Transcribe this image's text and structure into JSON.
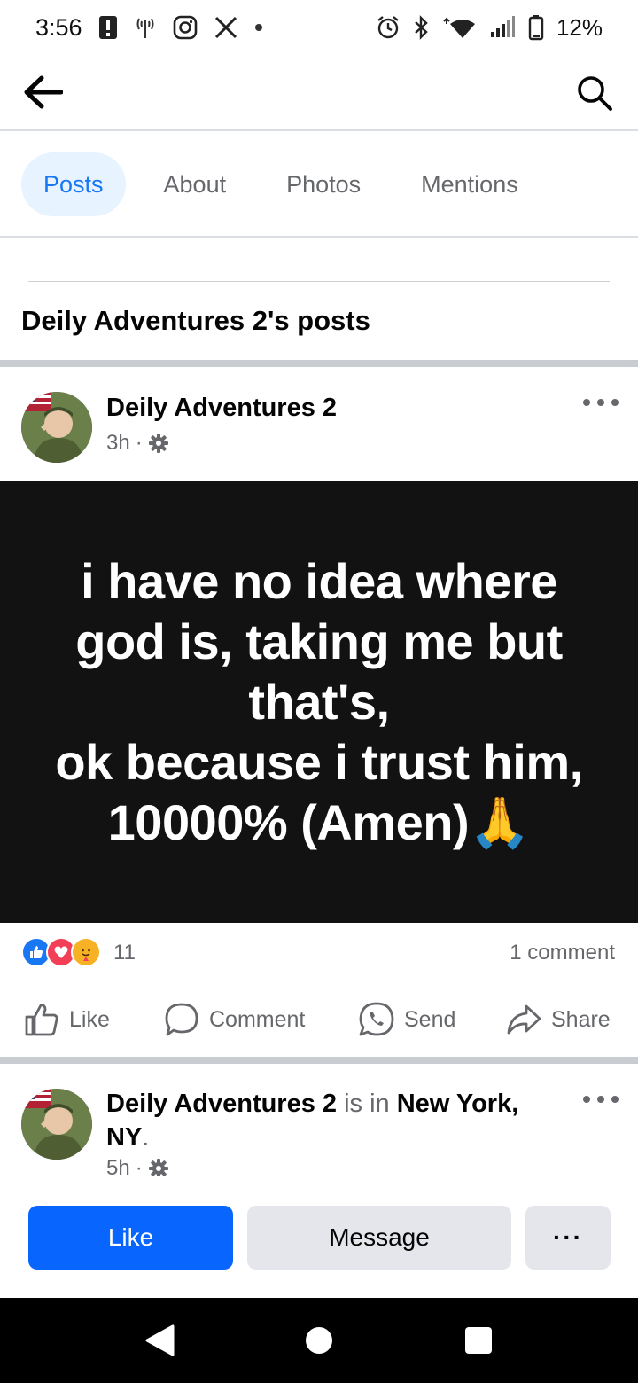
{
  "status_bar": {
    "time": "3:56",
    "battery_percent": "12%",
    "icons": [
      "alert-icon",
      "signal-tower-icon",
      "instagram-icon",
      "x-icon",
      "dot-icon",
      "alarm-icon",
      "bluetooth-icon",
      "wifi-icon",
      "cell-signal-icon",
      "battery-icon"
    ]
  },
  "header": {
    "back_icon": "arrow-left-icon",
    "search_icon": "search-icon"
  },
  "tabs": [
    {
      "label": "Posts",
      "active": true
    },
    {
      "label": "About",
      "active": false
    },
    {
      "label": "Photos",
      "active": false
    },
    {
      "label": "Mentions",
      "active": false
    }
  ],
  "section_title": "Deily Adventures 2's posts",
  "post1": {
    "author": "Deily Adventures 2",
    "time": "3h",
    "separator": "·",
    "privacy_icon": "gear-icon",
    "text_lines": [
      "i have no idea where",
      "god is, taking me but",
      "that's,",
      "ok because i trust him,",
      "10000% (Amen)🙏"
    ],
    "reactions": [
      "like",
      "love",
      "care"
    ],
    "reaction_count": "11",
    "comment_count": "1 comment",
    "actions": {
      "like": "Like",
      "comment": "Comment",
      "send": "Send",
      "share": "Share"
    }
  },
  "post2": {
    "author": "Deily Adventures 2",
    "is_in": "is in",
    "location": "New York, NY",
    "period": ".",
    "time": "5h",
    "separator": "·"
  },
  "bottom_bar": {
    "like": "Like",
    "message": "Message",
    "more": "···"
  },
  "colors": {
    "brand_blue": "#0866ff",
    "tab_active_bg": "#e7f3ff",
    "tab_active_text": "#1877f2",
    "post_bg": "#121212"
  }
}
